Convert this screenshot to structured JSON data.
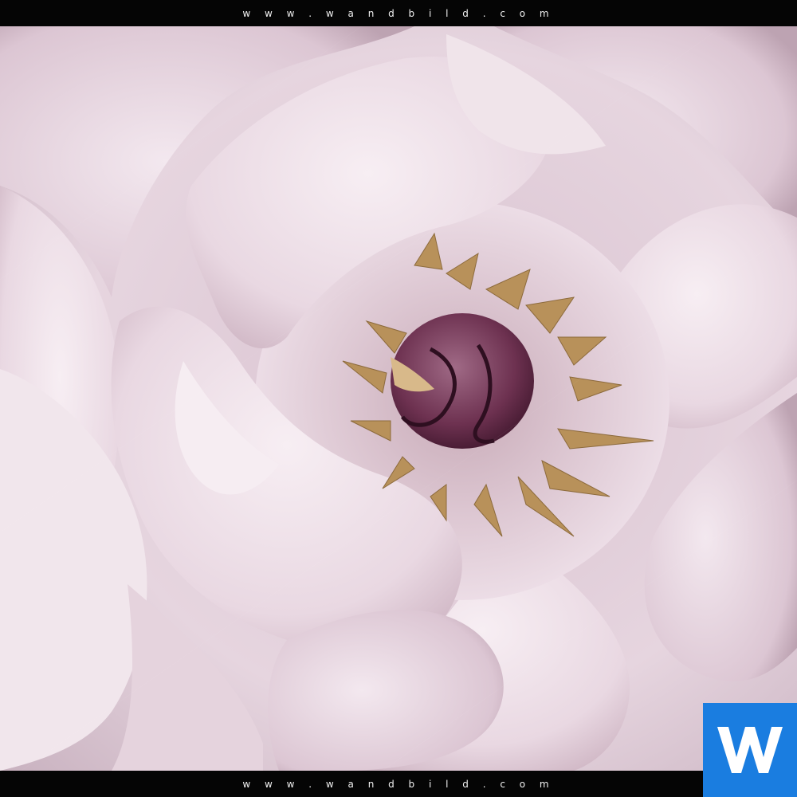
{
  "watermark": {
    "top_text": "w w w . w a n d b i l d . c o m",
    "bottom_text": "w w w . w a n d b i l d . c o m",
    "tiled_text": "www.wandbild.com"
  },
  "logo": {
    "letter": "W",
    "color": "#1a7de0"
  },
  "photo": {
    "subject": "pink-peony-flower",
    "petal_color": "#ead9e4",
    "center_color": "#7a3d5c",
    "stamen_color": "#b8915a"
  }
}
